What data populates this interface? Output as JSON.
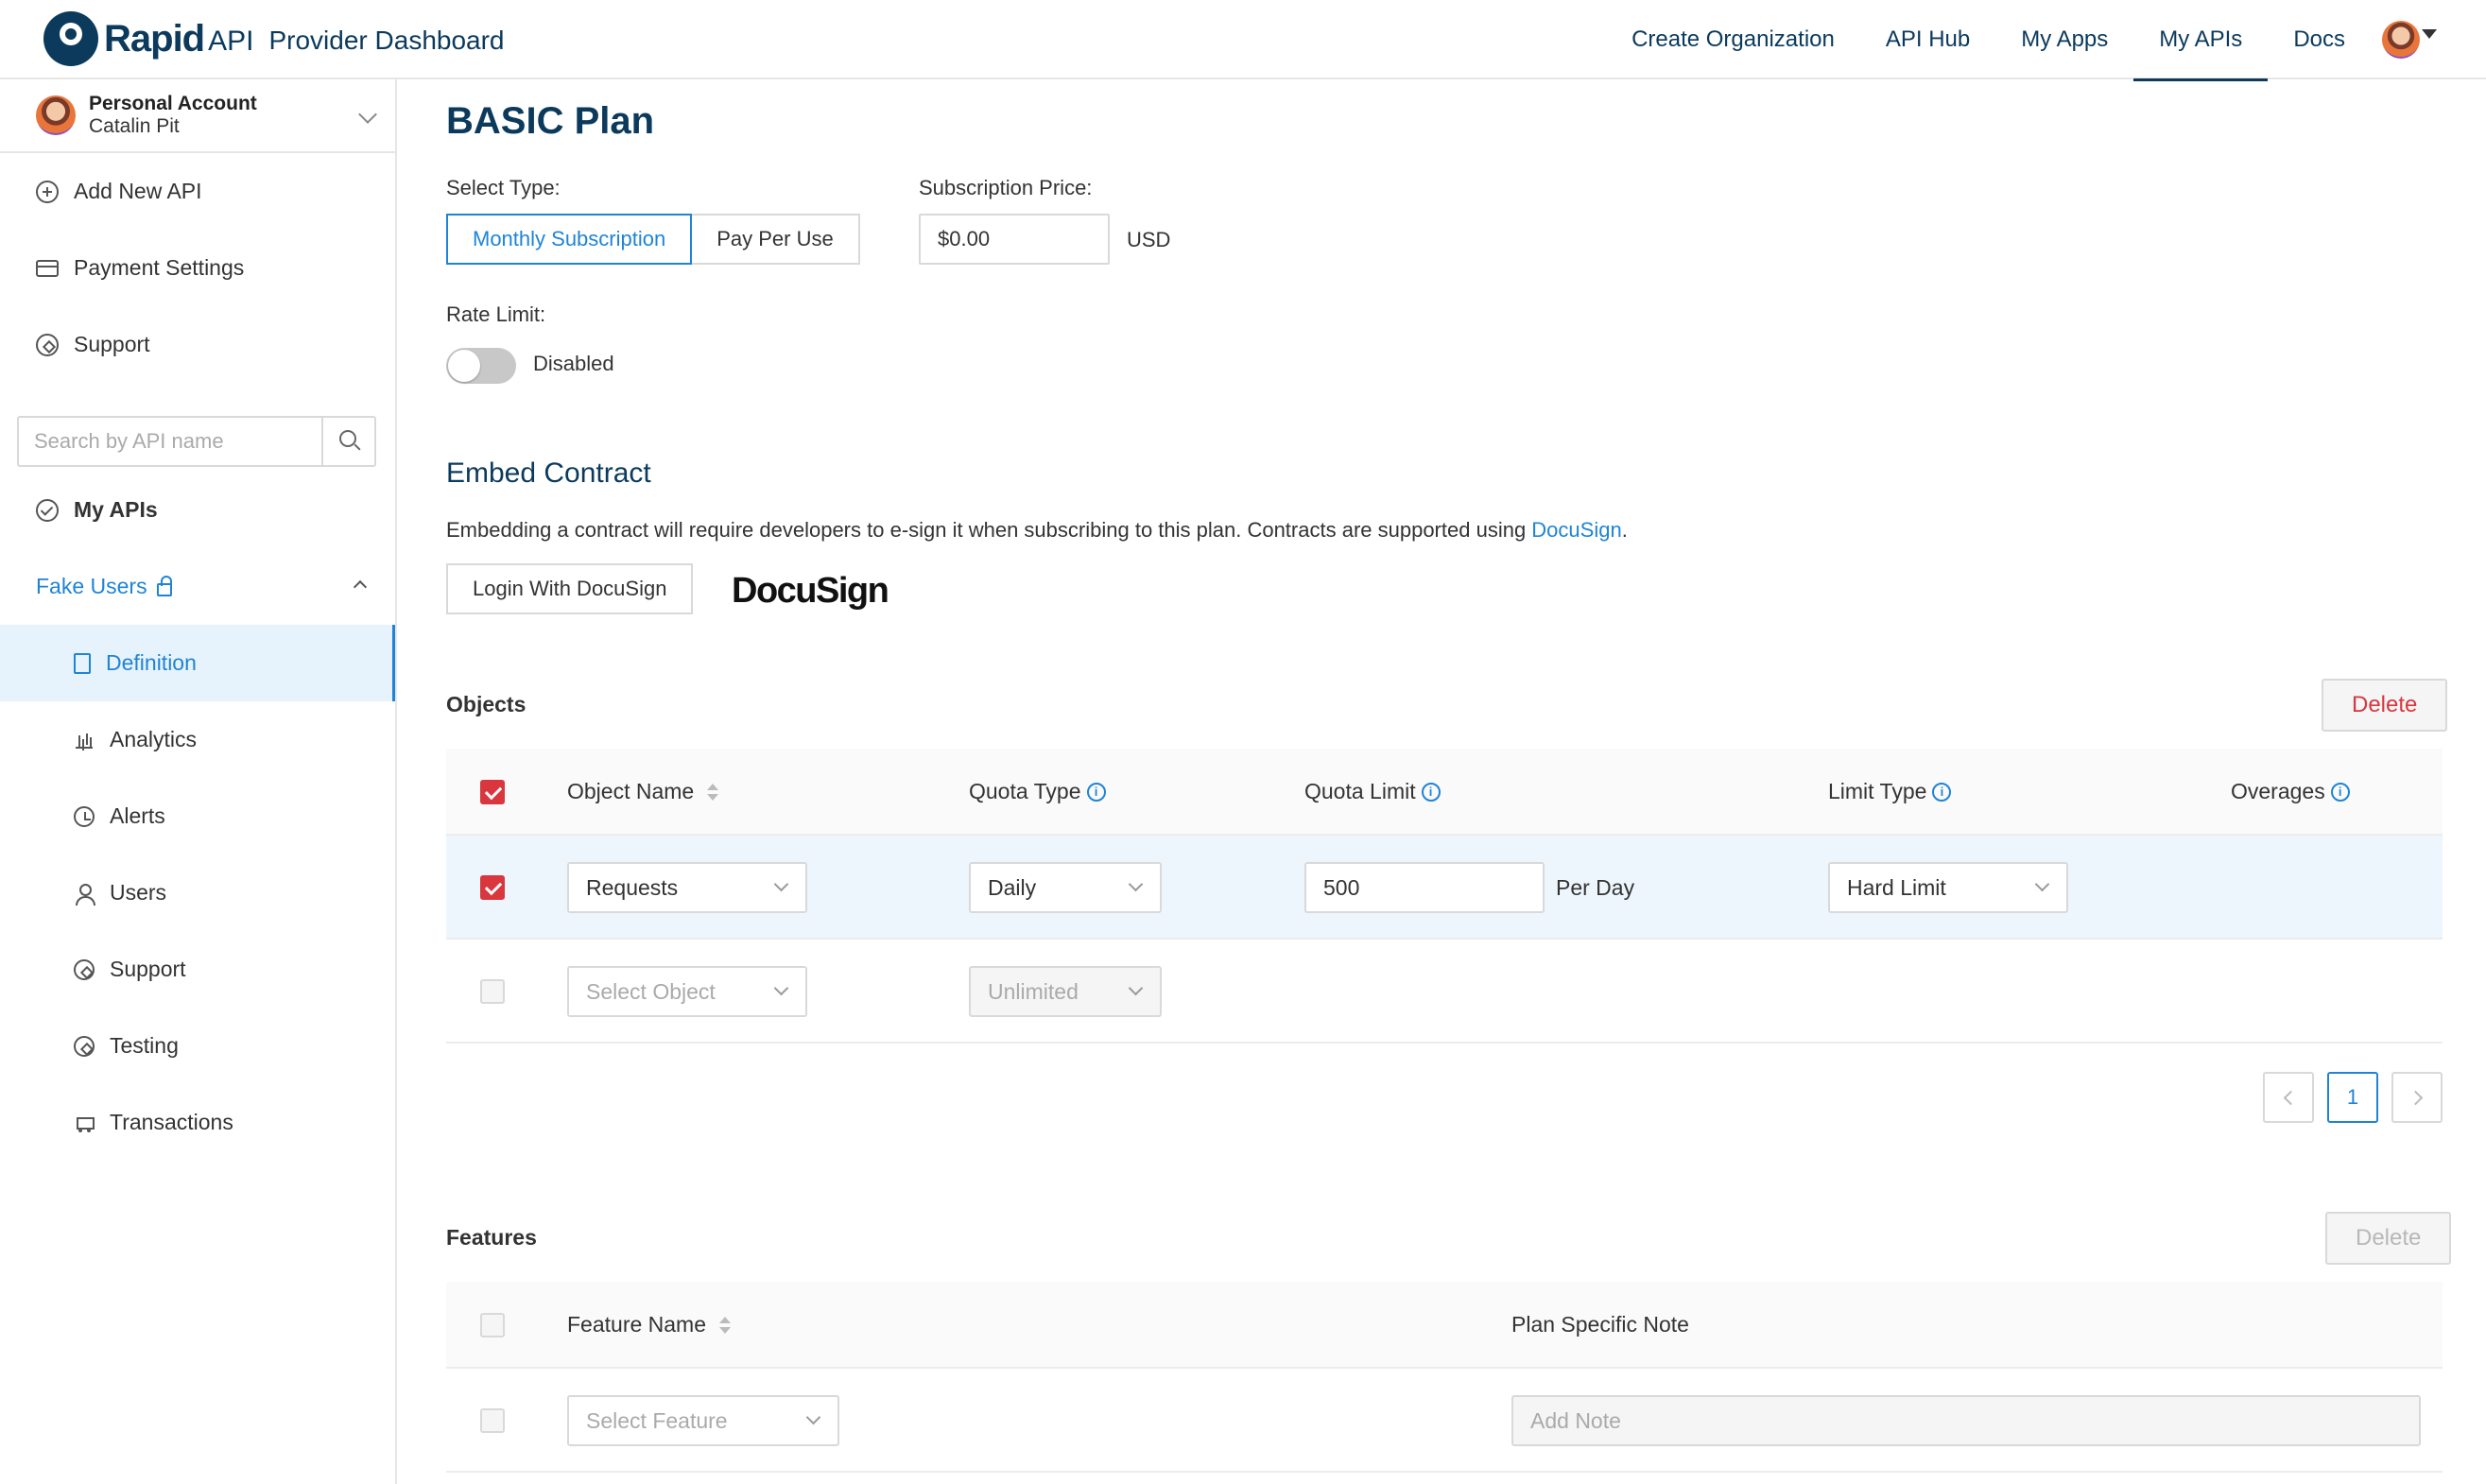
{
  "header": {
    "brand_rapid": "Rapid",
    "brand_api": "API",
    "brand_sub": "Provider Dashboard",
    "nav": [
      "Create Organization",
      "API Hub",
      "My Apps",
      "My APIs",
      "Docs"
    ],
    "active_nav": "My APIs"
  },
  "sidebar": {
    "account_title": "Personal Account",
    "account_name": "Catalin Pit",
    "add_new_api": "Add New API",
    "payment_settings": "Payment Settings",
    "support": "Support",
    "search_placeholder": "Search by API name",
    "my_apis": "My APIs",
    "api_name": "Fake Users",
    "sub_items": [
      "Definition",
      "Analytics",
      "Alerts",
      "Users",
      "Support",
      "Testing",
      "Transactions"
    ],
    "active_sub_item": "Definition"
  },
  "plan": {
    "title": "BASIC Plan",
    "select_type_label": "Select Type:",
    "type_options": [
      "Monthly Subscription",
      "Pay Per Use"
    ],
    "selected_type": "Monthly Subscription",
    "price_label": "Subscription Price:",
    "price_value": "$0.00",
    "currency": "USD",
    "rate_limit_label": "Rate Limit:",
    "rate_limit_status": "Disabled"
  },
  "embed": {
    "title": "Embed Contract",
    "text": "Embedding a contract will require developers to e-sign it when subscribing to this plan. Contracts are supported using ",
    "link": "DocuSign",
    "text_end": ".",
    "login_button": "Login With DocuSign",
    "logo_text": "DocuSign"
  },
  "objects": {
    "title": "Objects",
    "delete_label": "Delete",
    "columns": [
      "Object Name",
      "Quota Type",
      "Quota Limit",
      "Limit Type",
      "Overages"
    ],
    "rows": [
      {
        "checked": true,
        "object": "Requests",
        "quota_type": "Daily",
        "quota_limit": "500",
        "unit": "Per Day",
        "limit_type": "Hard Limit"
      },
      {
        "checked": false,
        "object": "Select Object",
        "quota_type": "Unlimited"
      }
    ],
    "current_page": "1"
  },
  "features": {
    "title": "Features",
    "delete_label": "Delete",
    "columns": [
      "Feature Name",
      "Plan Specific Note"
    ],
    "row": {
      "feature_placeholder": "Select Feature",
      "note_placeholder": "Add Note"
    }
  },
  "colors": {
    "brand": "#0b3a5c",
    "accent": "#1f84d6",
    "danger": "#d9363e"
  }
}
